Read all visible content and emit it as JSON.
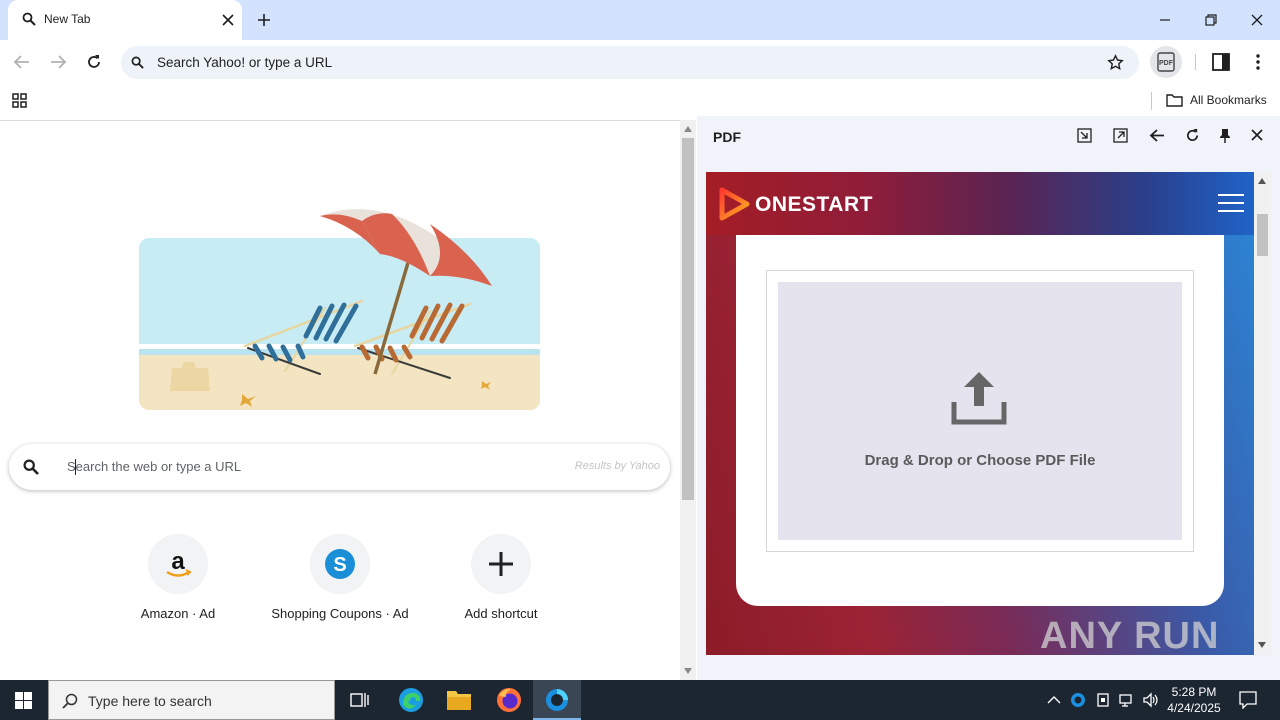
{
  "browser": {
    "tab": {
      "title": "New Tab"
    },
    "omnibox": {
      "placeholder": "Search Yahoo! or type a URL"
    },
    "bookmarks": {
      "all_bookmarks": "All Bookmarks"
    }
  },
  "ntp": {
    "search": {
      "placeholder": "Search the web or type a URL",
      "provider": "Results by Yahoo"
    },
    "shortcuts": [
      {
        "label": "Amazon · Ad",
        "icon": "amazon-icon"
      },
      {
        "label": "Shopping Coupons · Ad",
        "icon": "coupons-icon"
      },
      {
        "label": "Add shortcut",
        "icon": "plus-icon"
      }
    ]
  },
  "side_panel": {
    "title": "PDF",
    "brand": "ONESTART",
    "drop_label": "Drag & Drop or Choose PDF File"
  },
  "watermark": "ANY RUN",
  "taskbar": {
    "search_placeholder": "Type here to search",
    "time": "5:28 PM",
    "date": "4/24/2025"
  },
  "colors": {
    "tabstrip": "#d3e3fd",
    "omnibox": "#eef2f9",
    "side_panel": "#f0f4fa",
    "taskbar": "#1c2631",
    "brand_red": "#a41d25",
    "brand_blue": "#1f63c8"
  }
}
